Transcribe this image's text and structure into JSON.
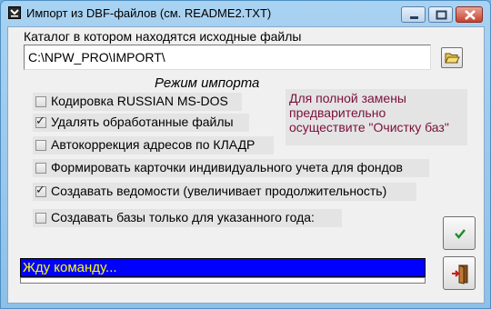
{
  "window": {
    "title": "Импорт из DBF-файлов (см. README2.TXT)",
    "icons": [
      "app-icon",
      "minimize-icon",
      "maximize-icon",
      "close-icon"
    ]
  },
  "catalog": {
    "label": "Каталог в котором находятся исходные файлы",
    "value": "C:\\NPW_PRO\\IMPORT\\",
    "browse_icon": "folder-open-icon"
  },
  "mode": {
    "title": "Режим импорта",
    "options": [
      {
        "label": "Кодировка RUSSIAN MS-DOS",
        "checked": false
      },
      {
        "label": "Удалять обработанные файлы",
        "checked": true
      },
      {
        "label": "Автокоррекция адресов по КЛАДР",
        "checked": false
      },
      {
        "label": "Формировать карточки индивидуального учета для фондов",
        "checked": false
      },
      {
        "label": "Создавать ведомости (увеличивает продолжительность)",
        "checked": true
      },
      {
        "label": "Создавать базы только для указанного года:",
        "checked": false
      }
    ]
  },
  "note": {
    "lines": [
      "Для полной замены",
      "предварительно",
      "осуществите \"Очистку баз\""
    ],
    "color": "#7b0f3b"
  },
  "status": {
    "text": "Жду команду...",
    "bg": "#0000ff",
    "fg": "#ffff00"
  },
  "buttons": {
    "ok_icon": "checkmark-icon",
    "exit_icon": "exit-door-icon"
  }
}
